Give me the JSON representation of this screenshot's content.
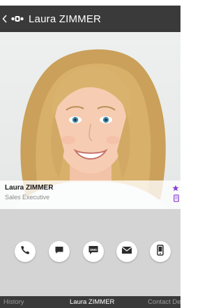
{
  "header": {
    "title": "Laura ZIMMER"
  },
  "contact": {
    "name": "Laura ZIMMER",
    "role": "Sales Executive"
  },
  "actions": [
    {
      "icon": "phone-icon"
    },
    {
      "icon": "chat-icon"
    },
    {
      "icon": "sms-icon",
      "label": "SMS"
    },
    {
      "icon": "email-icon"
    },
    {
      "icon": "mobile-device-icon"
    }
  ],
  "tabs": {
    "left": "History",
    "center": "Laura ZIMMER",
    "right": "Contact De"
  },
  "colors": {
    "action_bar": "#3a3a3a",
    "accent": "#8a3fd1",
    "action_area": "#d4d4d4",
    "icon_dark": "#2b2b2b"
  }
}
